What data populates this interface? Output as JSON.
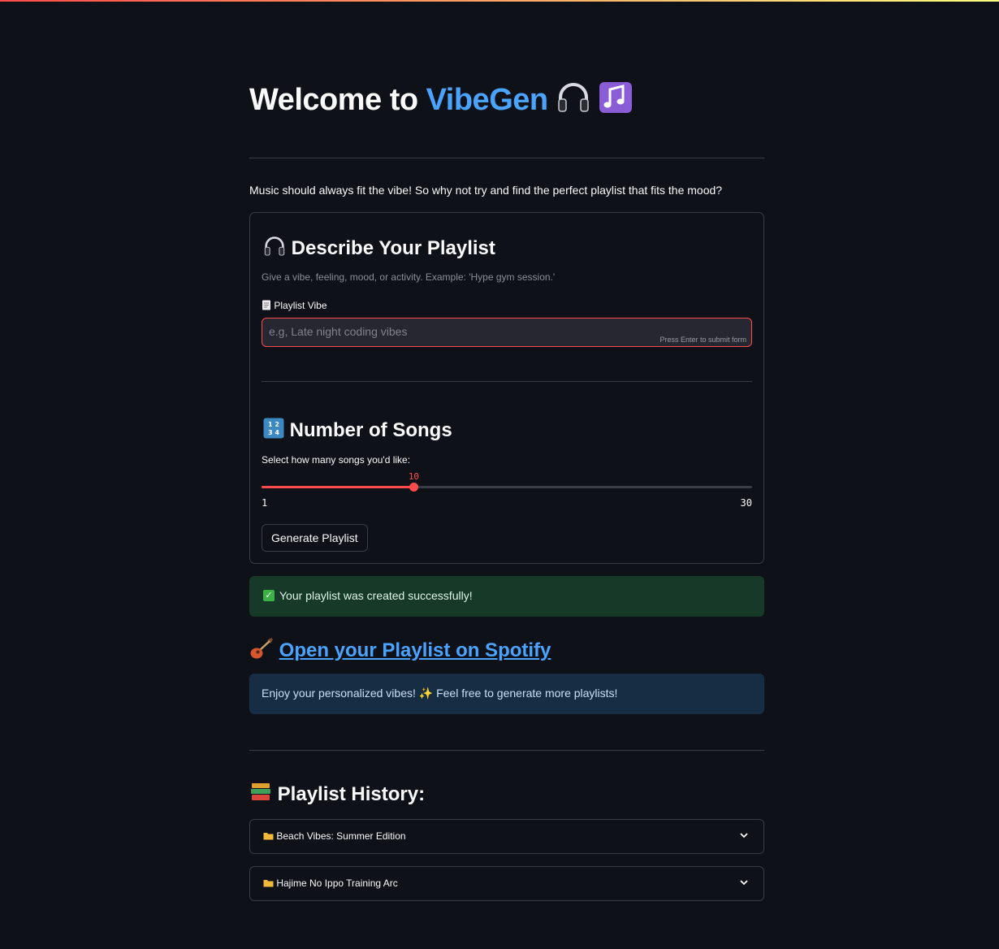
{
  "header": {
    "title_prefix": "Welcome to ",
    "title_accent": "VibeGen",
    "title_emoji": "🎧 🎶",
    "intro": "Music should always fit the vibe! So why not try and find the perfect playlist that fits the mood?"
  },
  "form": {
    "heading": "Describe Your Playlist",
    "heading_icon": "headphones-icon",
    "caption": "Give a vibe, feeling, mood, or activity. Example: 'Hype gym session.'",
    "vibe_label": "Playlist Vibe",
    "vibe_icon": "memo-icon",
    "vibe_value": "",
    "vibe_placeholder": "e.g, Late night coding vibes",
    "vibe_hint": "Press Enter to submit form",
    "songs_heading": "Number of Songs",
    "songs_icon": "numbers-icon",
    "songs_label": "Select how many songs you'd like:",
    "slider": {
      "value": 10,
      "min": 1,
      "max": 30,
      "value_text": "10",
      "min_text": "1",
      "max_text": "30"
    },
    "generate_label": "Generate Playlist"
  },
  "success": {
    "icon": "check-icon",
    "text": "Your playlist was created successfully!"
  },
  "spotify": {
    "icon": "guitar-icon",
    "link_text": "Open your Playlist on Spotify"
  },
  "info": {
    "text": "Enjoy your personalized vibes! ✨ Feel free to generate more playlists!"
  },
  "history": {
    "heading": "Playlist History:",
    "icon": "books-icon",
    "items": [
      {
        "label": "Beach Vibes: Summer Edition",
        "icon": "folder-icon"
      },
      {
        "label": "Hajime No Ippo Training Arc",
        "icon": "folder-icon"
      }
    ]
  },
  "colors": {
    "accent": "#4aa3ff",
    "primary": "#ff4b4b",
    "background": "#0e1117",
    "success_bg": "#173928",
    "info_bg": "#172d43"
  }
}
